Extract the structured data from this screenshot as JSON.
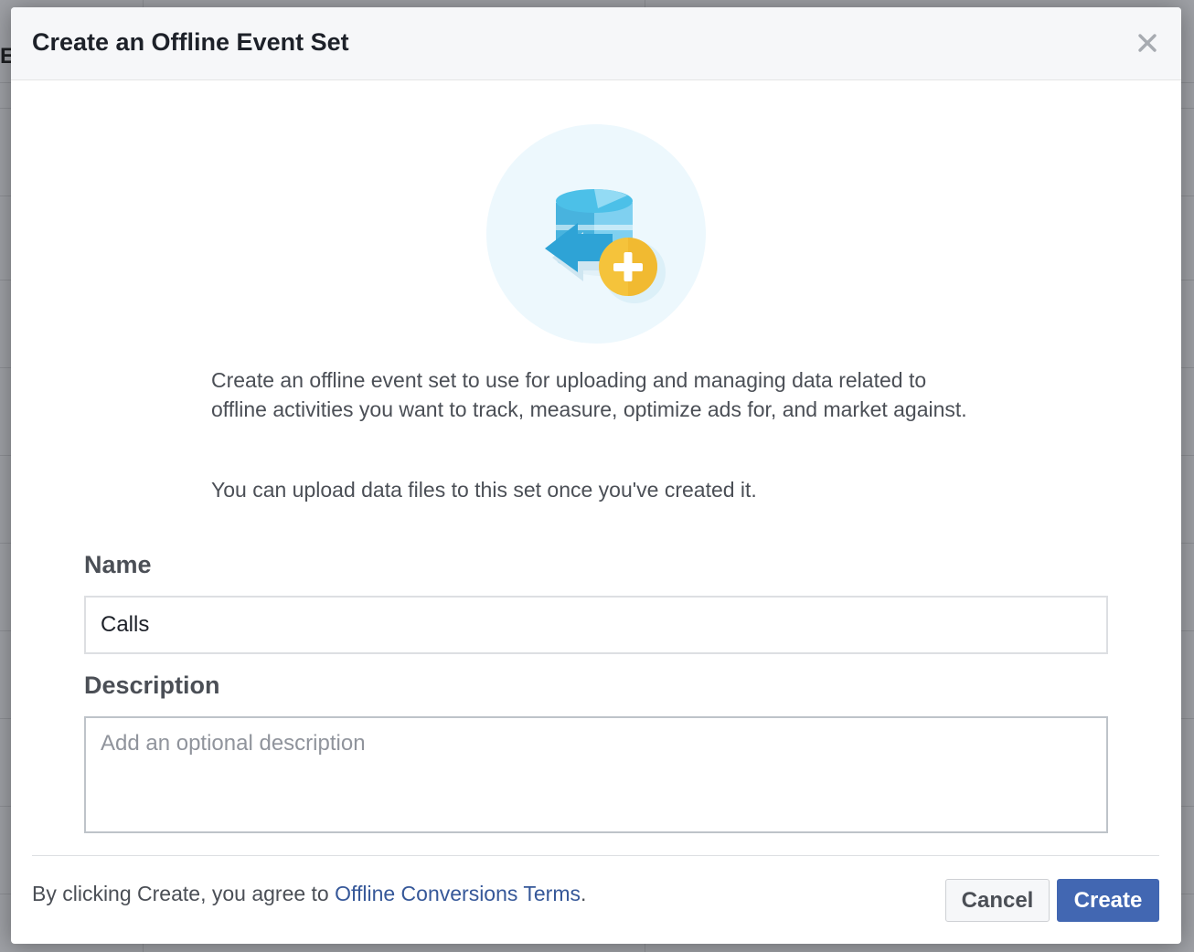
{
  "dialog": {
    "title": "Create an Offline Event Set",
    "close_icon": "close-icon",
    "illustration_icon": "database-add-icon"
  },
  "intro": {
    "paragraph_1": "Create an offline event set to use for uploading and managing data related to offline activities you want to track, measure, optimize ads for, and market against.",
    "paragraph_2": "You can upload data files to this set once you've created it."
  },
  "form": {
    "name_label": "Name",
    "name_value": "Calls",
    "description_label": "Description",
    "description_placeholder": "Add an optional description",
    "description_value": ""
  },
  "footer": {
    "terms_prefix": "By clicking Create, you agree to ",
    "terms_link": "Offline Conversions Terms",
    "terms_suffix": ".",
    "cancel_label": "Cancel",
    "create_label": "Create"
  },
  "background": {
    "partial_text": "E"
  },
  "colors": {
    "primary_button": "#4267b2",
    "link": "#365899",
    "illustration_bg": "#edf8fd",
    "accent_yellow": "#f5c33b",
    "accent_blue": "#4cc0e8"
  }
}
